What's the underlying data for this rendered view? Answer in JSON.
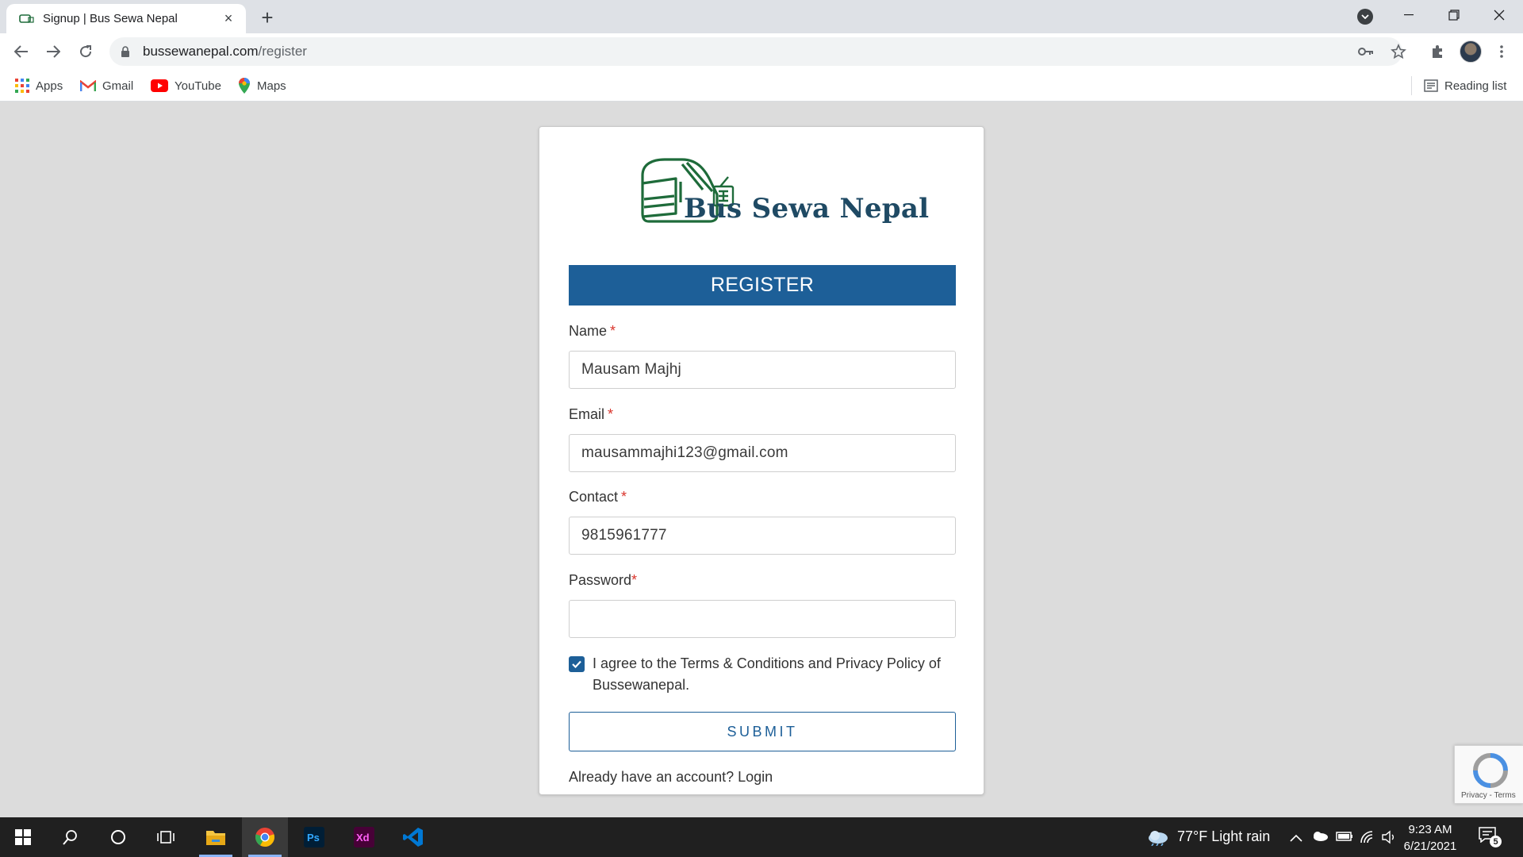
{
  "browser": {
    "tab_title": "Signup | Bus Sewa Nepal",
    "tab_close": "×",
    "new_tab": "+",
    "url_host": "bussewanepal.com",
    "url_path": "/register",
    "bookmarks": [
      "Apps",
      "Gmail",
      "YouTube",
      "Maps"
    ],
    "reading_list": "Reading list"
  },
  "page": {
    "logo_text": "Bus Sewa Nepal",
    "heading": "REGISTER",
    "fields": {
      "name_label": "Name",
      "name_value": "Mausam Majhj",
      "email_label": "Email",
      "email_value": "mausammajhi123@gmail.com",
      "contact_label": "Contact",
      "contact_value": "9815961777",
      "password_label": "Password",
      "password_value": "",
      "required_mark": "*"
    },
    "agree_text": "I agree to the Terms & Conditions and Privacy Policy of Bussewanepal.",
    "agree_checked": true,
    "submit_label": "SUBMIT",
    "login_prompt": "Already have an account? Login",
    "recaptcha_links": "Privacy - Terms"
  },
  "taskbar": {
    "weather": "77°F  Light rain",
    "time": "9:23 AM",
    "date": "6/21/2021",
    "notifications": "5"
  },
  "colors": {
    "primary": "#1d5f98",
    "logo_green": "#1e6b3a",
    "required": "#d9342b"
  }
}
